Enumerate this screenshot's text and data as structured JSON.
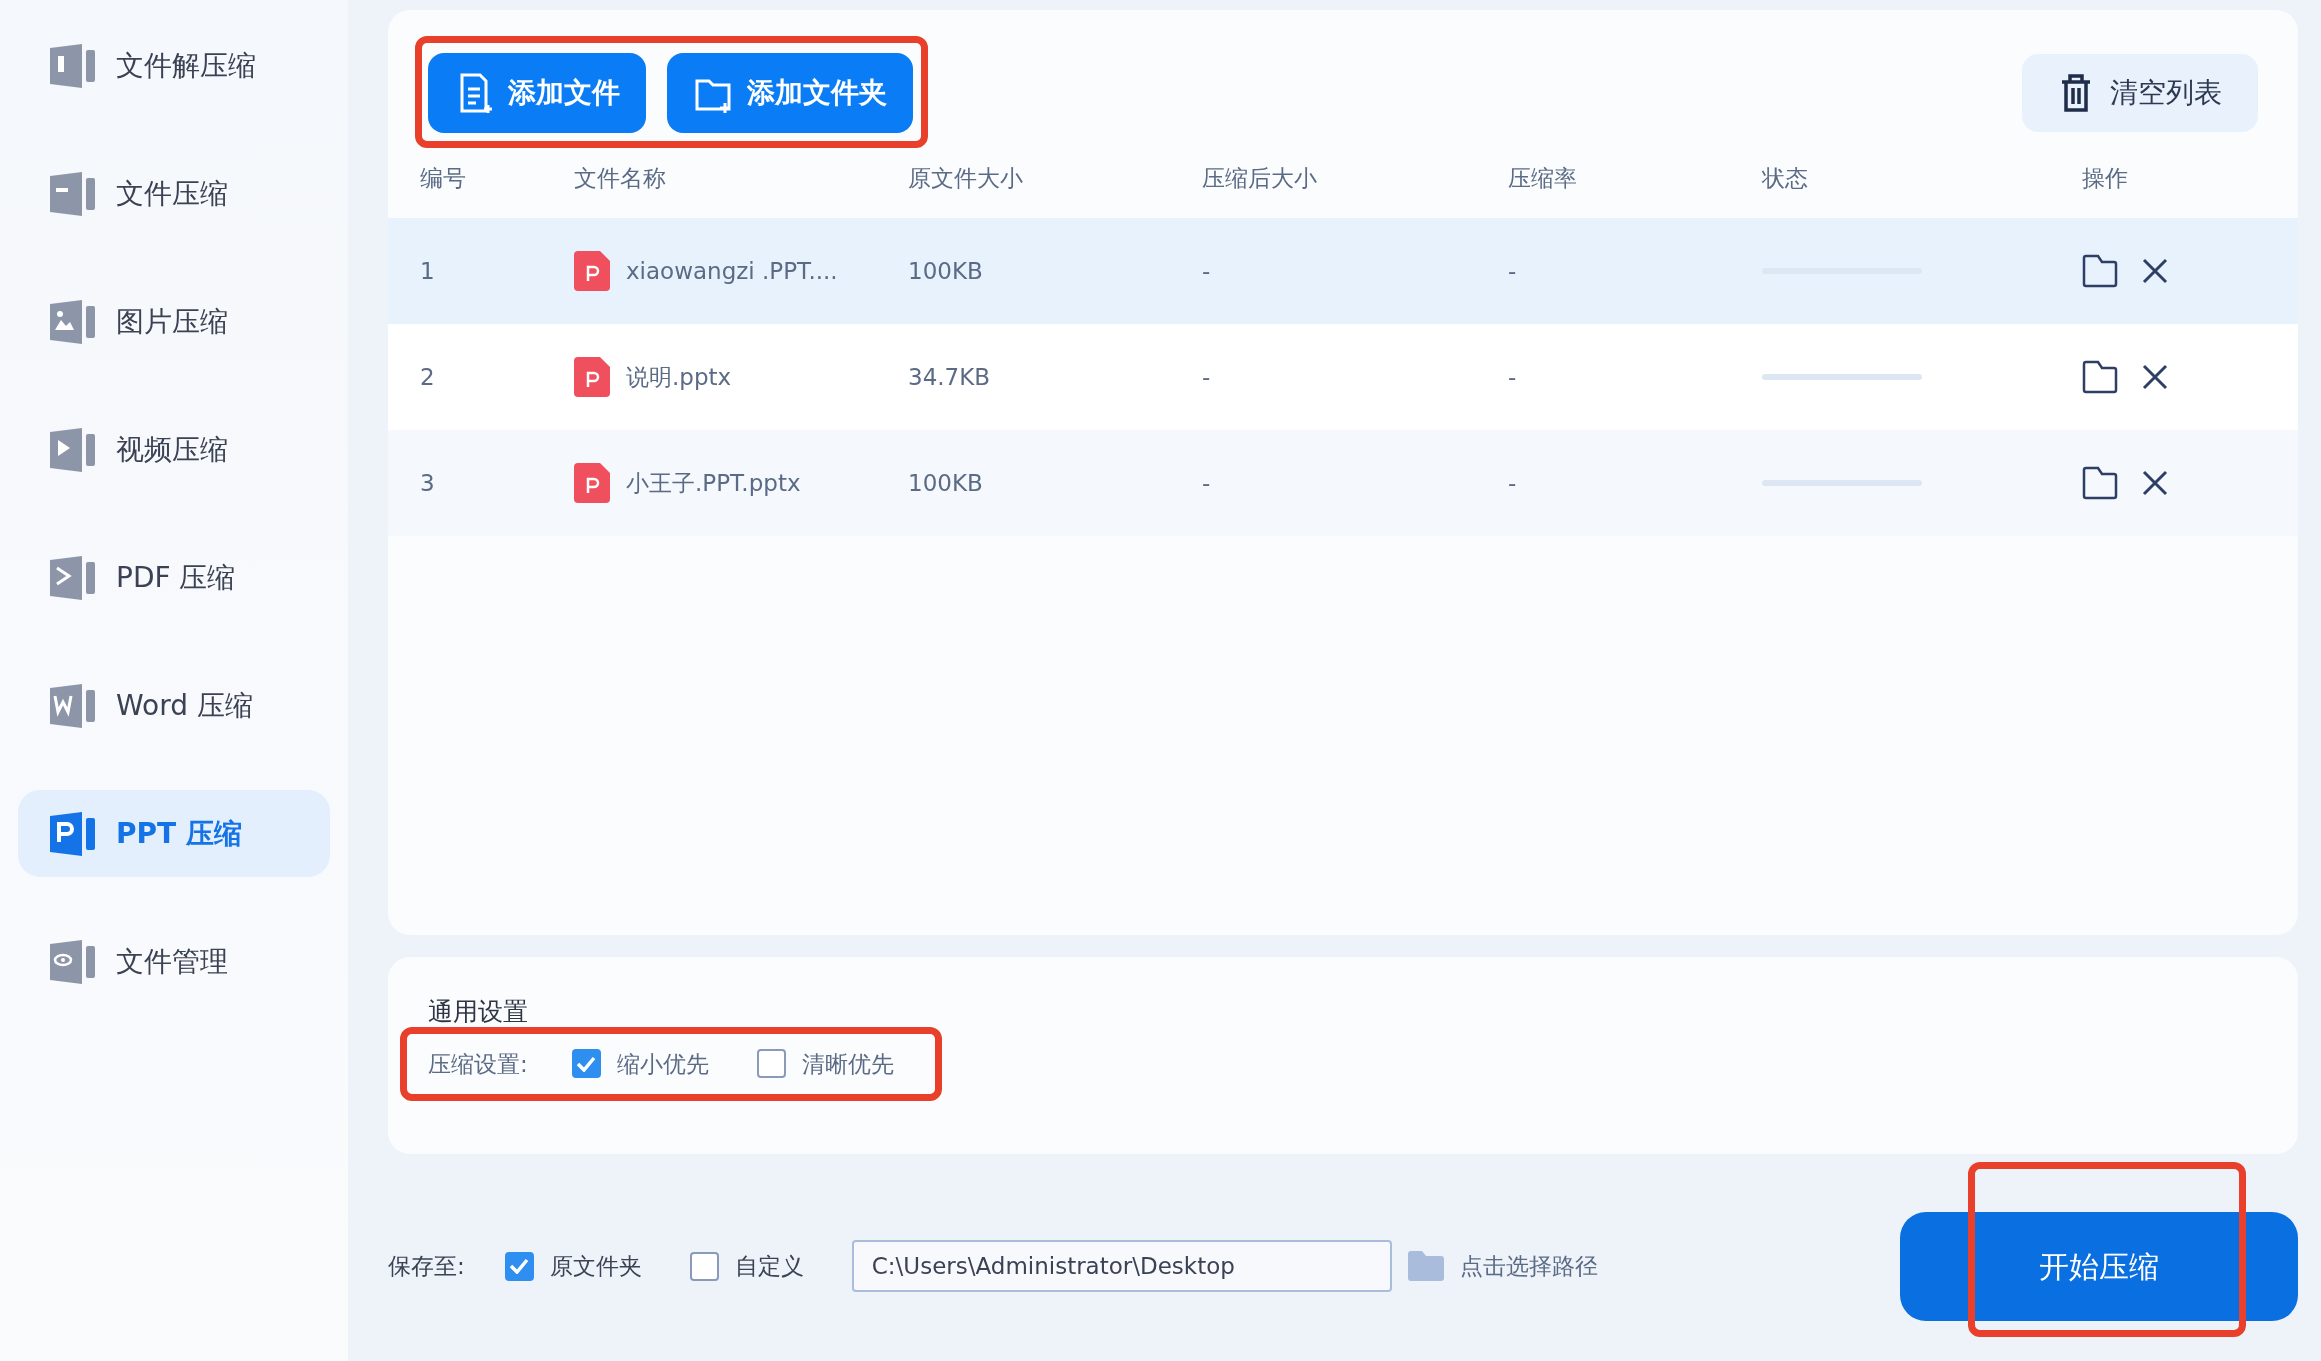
{
  "sidebar": {
    "items": [
      {
        "label": "文件解压缩",
        "selected": false
      },
      {
        "label": "文件压缩",
        "selected": false
      },
      {
        "label": "图片压缩",
        "selected": false
      },
      {
        "label": "视频压缩",
        "selected": false
      },
      {
        "label": "PDF 压缩",
        "selected": false
      },
      {
        "label": "Word 压缩",
        "selected": false
      },
      {
        "label": "PPT 压缩",
        "selected": true
      },
      {
        "label": "文件管理",
        "selected": false
      }
    ]
  },
  "toolbar": {
    "highlighted": true,
    "buttons": [
      "添加文件",
      "添加文件夹"
    ],
    "clear_button": "清空列表"
  },
  "table": {
    "columns": [
      "编号",
      "文件名称",
      "原文件大小",
      "压缩后大小",
      "压缩率",
      "状态",
      "操作"
    ],
    "rows": [
      {
        "number": "1",
        "name": "xiaowangzi .PPT....",
        "size": "100KB",
        "compressed_size": "-",
        "ratio": "-",
        "level": 0,
        "selected": true
      },
      {
        "number": "2",
        "name": "说明.pptx",
        "size": "34.7KB",
        "compressed_size": "-",
        "ratio": "-",
        "level": 0,
        "selected": false
      },
      {
        "number": "3",
        "name": "小王子.PPT.pptx",
        "size": "100KB",
        "compressed_size": "-",
        "ratio": "-",
        "level": 0,
        "selected": false
      }
    ]
  },
  "settings": {
    "title": "通用设置",
    "highlighted": true,
    "label": "压缩设置:",
    "options": [
      {
        "label": "缩小优先",
        "checked": true
      },
      {
        "label": "清晰优先",
        "checked": false
      }
    ]
  },
  "save": {
    "label": "保存至:",
    "options": [
      {
        "label": "原文件夹",
        "checked": true
      },
      {
        "label": "自定义",
        "checked": false
      }
    ],
    "path": "C:\\Users\\Administrator\\Desktop",
    "choose_link": "点击选择路径"
  },
  "start_button": {
    "label": "开始压缩",
    "highlighted": true
  }
}
